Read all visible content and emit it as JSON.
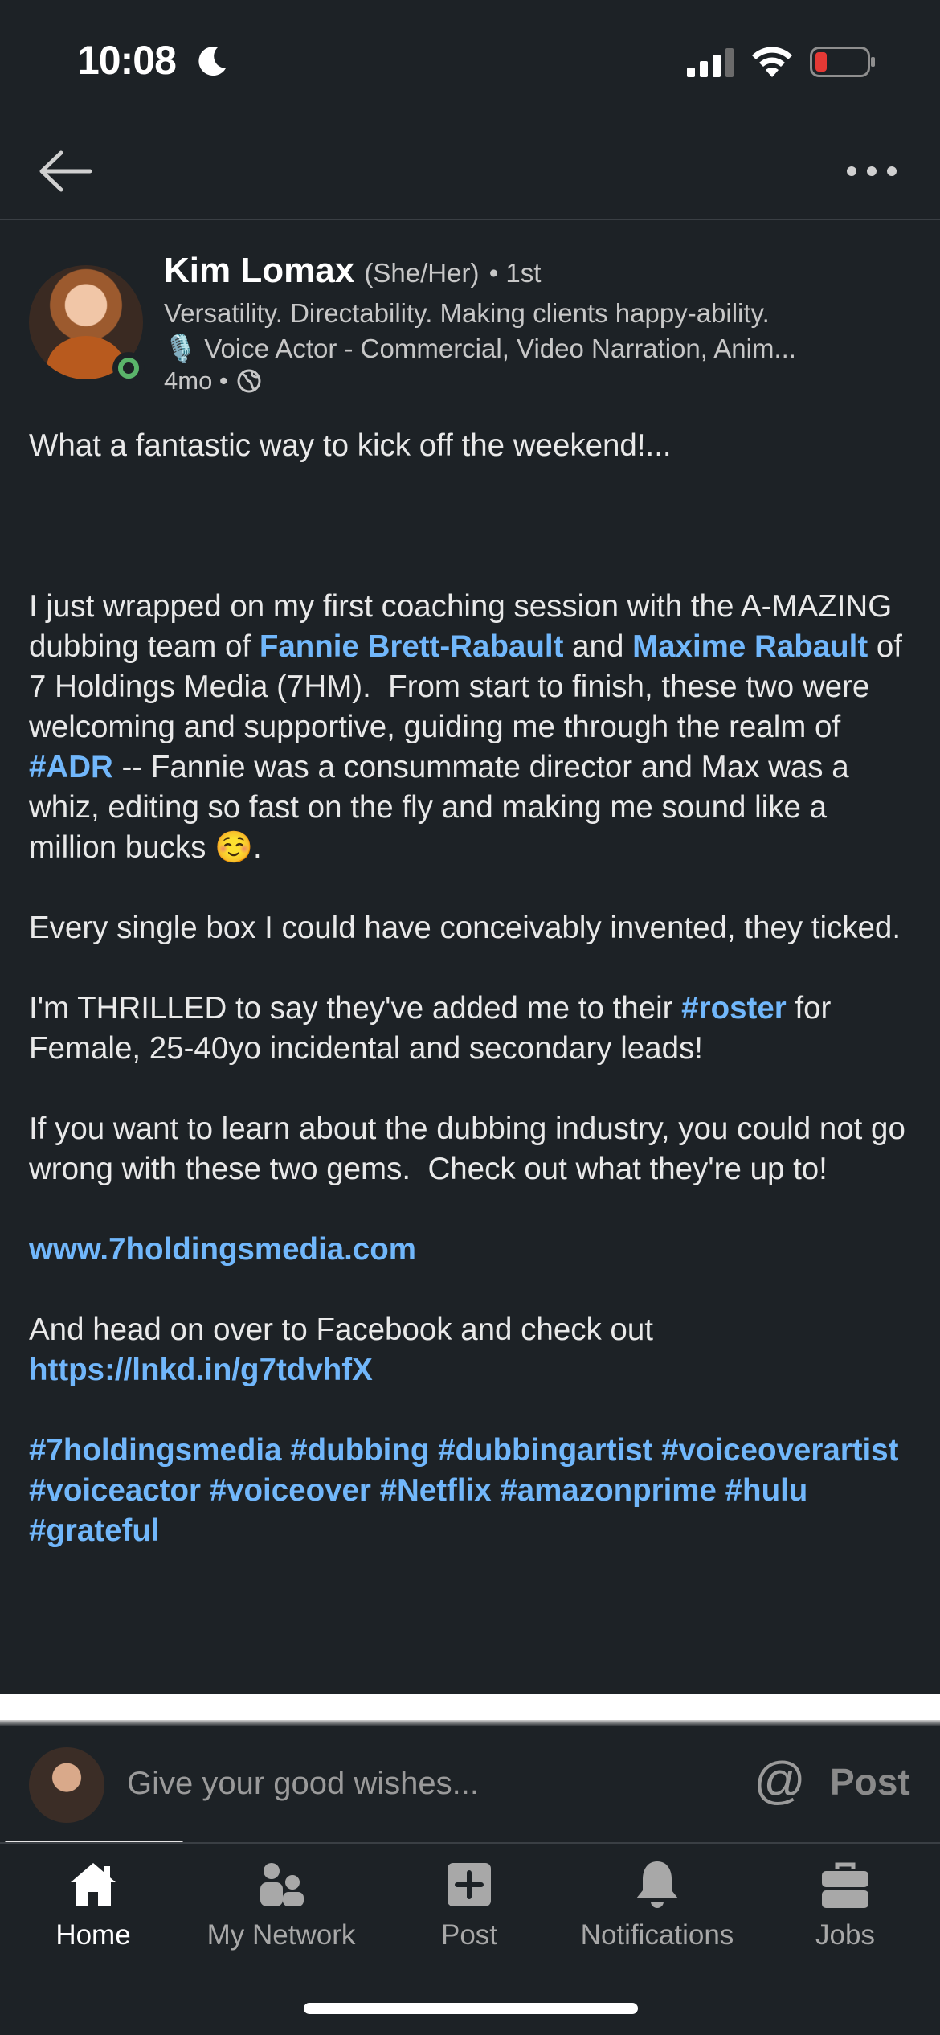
{
  "status": {
    "time": "10:08"
  },
  "post": {
    "author": {
      "name": "Kim Lomax",
      "pronouns": "(She/Her)",
      "degree": "• 1st",
      "headline_line1": "Versatility. Directability. Making clients happy-ability.",
      "headline_line2": "🎙️ Voice Actor - Commercial, Video Narration, Anim...",
      "time_ago": "4mo •"
    },
    "body": {
      "p1": "What a fantastic way to kick off the weekend!...",
      "p2_a": "I just wrapped on my first coaching session with the A-MAZING dubbing team of ",
      "mention1": "Fannie Brett-Rabault",
      "p2_b": " and ",
      "mention2": "Maxime Rabault",
      "p2_c": " of 7 Holdings Media (7HM).  From start to finish, these two were welcoming and supportive, guiding me through the realm of ",
      "hashtag_adr": "#ADR",
      "p2_d": " -- Fannie was a consummate director and Max was a whiz, editing so fast on the fly and making me sound like a million bucks ☺️.",
      "p3": "Every single box I could have conceivably invented, they ticked.",
      "p4_a": "I'm THRILLED to say they've added me to their ",
      "hashtag_roster": "#roster",
      "p4_b": " for Female, 25-40yo incidental and secondary leads!",
      "p5": "If you want to learn about the dubbing industry, you could not go wrong with these two gems.  Check out what they're up to!",
      "website": "www.7holdingsmedia.com",
      "p6_a": "And head on over to Facebook and check out ",
      "short_link": "https://lnkd.in/g7tdvhfX",
      "hashtags": "#7holdingsmedia #dubbing #dubbingartist #voiceoverartist #voiceactor #voiceover #Netflix #amazonprime #hulu #grateful"
    }
  },
  "comment": {
    "placeholder": "Give your good wishes...",
    "at_label": "@",
    "post_label": "Post"
  },
  "tabs": [
    {
      "label": "Home",
      "icon": "home-icon",
      "active": true
    },
    {
      "label": "My Network",
      "icon": "my-network-icon",
      "active": false
    },
    {
      "label": "Post",
      "icon": "post-plus-icon",
      "active": false
    },
    {
      "label": "Notifications",
      "icon": "bell-icon",
      "active": false
    },
    {
      "label": "Jobs",
      "icon": "briefcase-icon",
      "active": false
    }
  ],
  "colors": {
    "background": "#1d2226",
    "link": "#71b7fb",
    "online": "#5ab46a",
    "battery_low": "#e53935"
  }
}
